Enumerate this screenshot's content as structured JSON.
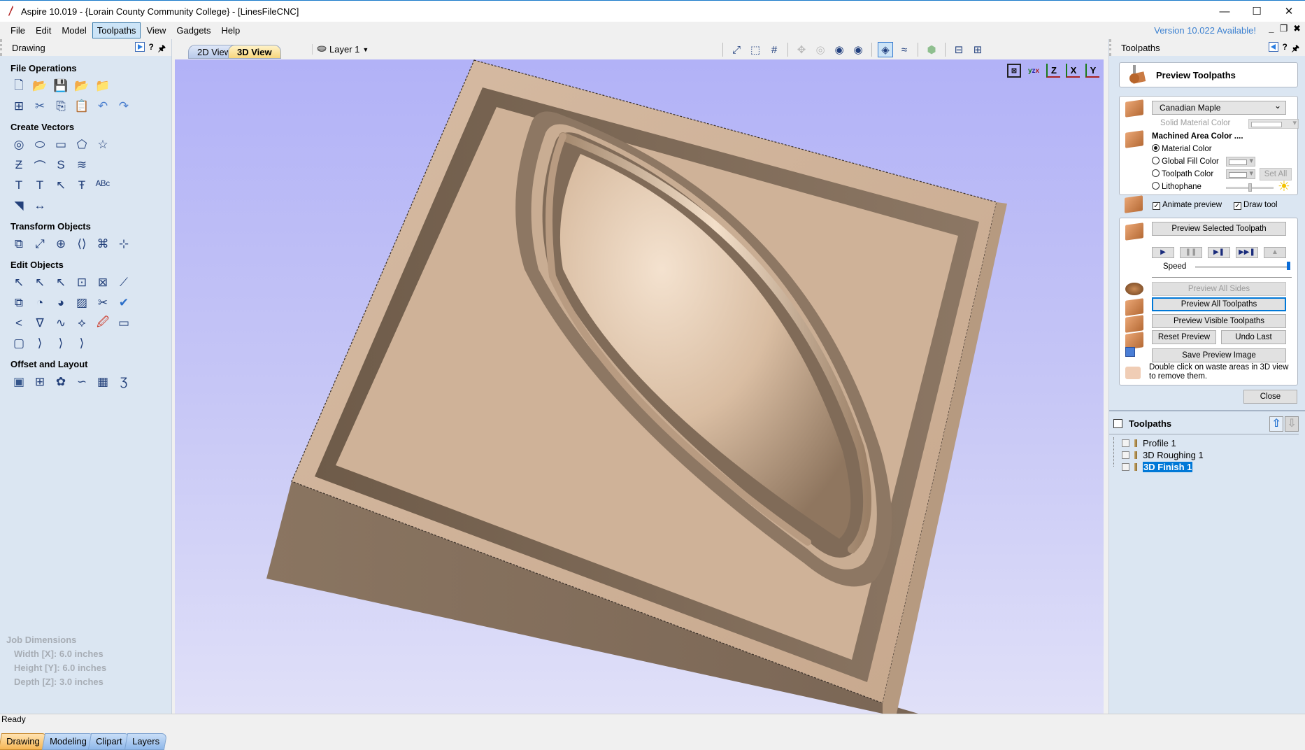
{
  "window": {
    "title": "Aspire 10.019 - {Lorain County Community College} - [LinesFileCNC]",
    "controls": [
      "minimize",
      "maximize",
      "close"
    ]
  },
  "menubar": {
    "items": [
      "File",
      "Edit",
      "Model",
      "Toolpaths",
      "View",
      "Gadgets",
      "Help"
    ],
    "active": "Toolpaths",
    "version_notice": "Version 10.022 Available!"
  },
  "left_panel": {
    "header": "Drawing",
    "help": "?",
    "sections": [
      {
        "title": "File Operations",
        "rows": [
          [
            "new-file-icon",
            "open-file-icon",
            "save-file-icon",
            "open-recent-icon",
            "import-icon"
          ],
          [
            "select-all-icon",
            "cut-icon",
            "copy-icon",
            "paste-icon",
            "undo-icon",
            "redo-icon"
          ]
        ]
      },
      {
        "title": "Create Vectors",
        "rows": [
          [
            "circle-icon",
            "ellipse-icon",
            "rectangle-icon",
            "polygon-icon",
            "star-icon"
          ],
          [
            "polyline-icon",
            "curve-icon",
            "spiral-icon",
            "wave-icon"
          ],
          [
            "text-icon",
            "text-box-icon",
            "text-on-curve-icon",
            "text-scale-icon",
            "text-arc-icon"
          ],
          [
            "import-bitmap-icon",
            "dimension-icon"
          ]
        ]
      },
      {
        "title": "Transform Objects",
        "rows": [
          [
            "move-icon",
            "scale-icon",
            "align-icon",
            "mirror-icon",
            "distort-icon",
            "center-icon"
          ]
        ]
      },
      {
        "title": "Edit Objects",
        "rows": [
          [
            "select-icon",
            "node-edit-icon",
            "transform-select-icon",
            "group-icon",
            "ungroup-icon",
            "measure-icon"
          ],
          [
            "weld-icon",
            "subtract-icon",
            "intersect-icon",
            "trim-hatch-icon",
            "scissors-icon",
            "validate-icon"
          ],
          [
            "fillet-icon",
            "smooth-icon",
            "curve-fit-icon",
            "join-icon",
            "trace-bitmap-icon",
            "close-vector-icon"
          ],
          [
            "bounding-box-icon",
            "corner-fillet-icon",
            "dogbone-icon",
            "tbone-icon"
          ]
        ]
      },
      {
        "title": "Offset and Layout",
        "rows": [
          [
            "offset-icon",
            "array-copy-icon",
            "circular-array-icon",
            "copy-along-path-icon",
            "nest-icon",
            "text-layout-icon"
          ]
        ]
      }
    ],
    "job_dimensions": {
      "title": "Job Dimensions",
      "width": "Width  [X]: 6.0 inches",
      "height": "Height [Y]: 6.0 inches",
      "depth": "Depth  [Z]: 3.0 inches"
    },
    "bottom_tabs": [
      "Drawing",
      "Modeling",
      "Clipart",
      "Layers"
    ],
    "active_tab": "Drawing"
  },
  "view_toolbar": {
    "tabs": [
      "2D View",
      "3D View"
    ],
    "active_tab": "3D View",
    "layer": "Layer 1",
    "icons": [
      "zoom-extents-icon",
      "zoom-selection-icon",
      "grid-icon",
      "pan-icon",
      "zoom-icon",
      "zoom-box-icon",
      "zoom-region-icon",
      "toolpath-preview-icon",
      "toolpath-display-icon",
      "model-shading-icon",
      "split-horizontal-icon",
      "split-vertical-icon"
    ],
    "selected_icon": "toolpath-preview-icon"
  },
  "viewport": {
    "orientation_icons": [
      "fit-view-icon",
      "iso-view-icon",
      "top-view-z-icon",
      "front-view-x-icon",
      "side-view-y-icon"
    ],
    "orientation_labels": [
      "",
      "",
      "Z",
      "X",
      "Y"
    ],
    "material_colors": {
      "top": "#d3b59b",
      "side": "#7d6a58",
      "dark": "#5f4f40",
      "dome_light": "#f1dcc6"
    }
  },
  "right_panel": {
    "header": "Toolpaths",
    "help": "?",
    "preview_title": "Preview Toolpaths",
    "material": {
      "selected": "Canadian Maple",
      "solid_material_color_label": "Solid Material Color",
      "machined_area_label": "Machined Area Color ....",
      "options": [
        {
          "label": "Material Color",
          "selected": true
        },
        {
          "label": "Global Fill Color",
          "selected": false
        },
        {
          "label": "Toolpath Color",
          "selected": false
        },
        {
          "label": "Lithophane",
          "selected": false
        }
      ],
      "set_all_label": "Set All",
      "lithophane_brightness": 0.5,
      "animate_preview_label": "Animate preview",
      "animate_preview_checked": true,
      "draw_tool_label": "Draw tool",
      "draw_tool_checked": true
    },
    "controls": {
      "preview_selected": "Preview Selected Toolpath",
      "play_buttons": [
        "play-icon",
        "pause-icon",
        "step-icon",
        "skip-to-end-icon",
        "go-to-top-icon"
      ],
      "play_glyphs": [
        "▶",
        "❚❚",
        "▶❚",
        "▶▶❚",
        "▲"
      ],
      "speed_label": "Speed",
      "speed_value": 1.0,
      "preview_all_sides": "Preview All Sides",
      "preview_all_toolpaths": "Preview All Toolpaths",
      "preview_visible_toolpaths": "Preview Visible Toolpaths",
      "reset_preview": "Reset Preview",
      "undo_last": "Undo Last",
      "save_preview_image": "Save Preview Image",
      "hint": "Double click on waste areas in 3D view to remove them."
    },
    "close_label": "Close",
    "toolpath_list": {
      "title": "Toolpaths",
      "items": [
        {
          "name": "Profile 1",
          "checked": false,
          "selected": false
        },
        {
          "name": "3D Roughing 1",
          "checked": false,
          "selected": false
        },
        {
          "name": "3D Finish 1",
          "checked": false,
          "selected": true
        }
      ]
    }
  },
  "statusbar": {
    "text": "Ready"
  }
}
